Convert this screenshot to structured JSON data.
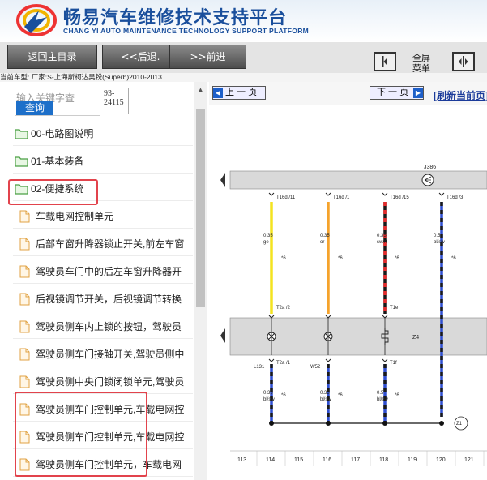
{
  "header": {
    "title_cn": "畅易汽车维修技术支持平台",
    "title_en": "CHANG YI AUTO MAINTENANCE TECHNOLOGY SUPPORT PLATFORM"
  },
  "toolbar": {
    "home_label": "返回主目录",
    "back_label": "<<后退.",
    "forward_label": ">>前进",
    "menu_label_1": "全屏",
    "menu_label_2": "菜单"
  },
  "car_info": "当前车型:  厂家:S-上海斯柯达昊锐(Superb)2010-2013",
  "search": {
    "placeholder": "输入关键字查",
    "button_label": "查询",
    "code_line_1": "93-",
    "code_line_2": "24115"
  },
  "tree": [
    {
      "label": "00-电路图说明",
      "type": "folder"
    },
    {
      "label": "01-基本装备",
      "type": "folder"
    },
    {
      "label": "02-便捷系统",
      "type": "folder"
    },
    {
      "label": "车载电网控制单元",
      "type": "doc"
    },
    {
      "label": "后部车窗升降器锁止开关,前左车窗",
      "type": "doc"
    },
    {
      "label": "驾驶员车门中的后左车窗升降器开",
      "type": "doc"
    },
    {
      "label": "后视镜调节开关，后视镜调节转换",
      "type": "doc"
    },
    {
      "label": "驾驶员侧车内上锁的按钮，驾驶员",
      "type": "doc"
    },
    {
      "label": "驾驶员侧车门接触开关,驾驶员侧中",
      "type": "doc"
    },
    {
      "label": "驾驶员侧中央门锁闭锁单元,驾驶员",
      "type": "doc"
    },
    {
      "label": "驾驶员侧车门控制单元,车载电网控",
      "type": "doc"
    },
    {
      "label": "驾驶员侧车门控制单元,车载电网控",
      "type": "doc"
    },
    {
      "label": "驾驶员侧车门控制单元，车载电网",
      "type": "doc"
    }
  ],
  "viewer": {
    "prev_label": "上 一 页",
    "next_label": "下 一 页",
    "refresh_label": "[刷新当前页]"
  },
  "diagram": {
    "bus_label": "J386",
    "component_label": "Z4",
    "ground_label": "Z1",
    "wires": [
      {
        "top_pin": "T16d /11",
        "size": "0.35",
        "color_code": "ge",
        "mid_pin": "T2a /2",
        "lower_label": "L131",
        "lower_pin": "T2a /1",
        "lower_size": "0.35",
        "lower_color": "bl/sw",
        "note": "*6"
      },
      {
        "top_pin": "T16d /1",
        "size": "0.35",
        "color_code": "or",
        "mid_pin": "",
        "lower_label": "W52",
        "lower_pin": "",
        "lower_size": "0.35",
        "lower_color": "bl/sw",
        "note": "*6"
      },
      {
        "top_pin": "T16d /15",
        "size": "0.35",
        "color_code": "sw/rt",
        "mid_pin": "T1e",
        "lower_label": "",
        "lower_pin": "T1f",
        "lower_size": "0.5",
        "lower_color": "bl/sw",
        "note": "*6"
      },
      {
        "top_pin": "T16d /3",
        "size": "0.5",
        "color_code": "bl/sw",
        "mid_pin": "",
        "lower_label": "",
        "lower_pin": "",
        "lower_size": "",
        "lower_color": "",
        "note": "*6"
      }
    ],
    "scale": [
      "113",
      "114",
      "115",
      "116",
      "117",
      "118",
      "119",
      "120",
      "121"
    ]
  },
  "colors": {
    "brand_blue": "#1a4f9c",
    "query_button": "#1d6fc9",
    "highlight_red": "#e2434c",
    "wire_yellow": "#f4e320",
    "wire_orange": "#f5a32c",
    "wire_black": "#1a1a1a",
    "wire_red": "#e62b2b",
    "wire_blue": "#2f4fd0"
  }
}
